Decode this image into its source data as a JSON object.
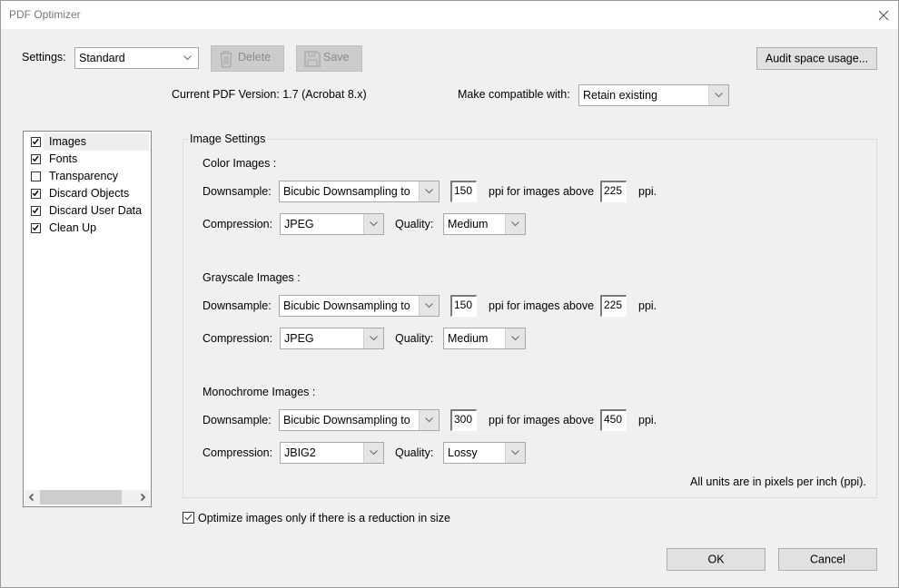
{
  "window": {
    "title": "PDF Optimizer",
    "close_icon": "close-icon"
  },
  "settings": {
    "label": "Settings:",
    "selected": "Standard",
    "delete_label": "Delete",
    "save_label": "Save",
    "audit_label": "Audit space usage..."
  },
  "version": {
    "current_text": "Current PDF Version: 1.7 (Acrobat 8.x)",
    "compat_label": "Make compatible with:",
    "compat_selected": "Retain existing"
  },
  "panels": [
    {
      "label": "Images",
      "checked": true,
      "selected": true
    },
    {
      "label": "Fonts",
      "checked": true,
      "selected": false
    },
    {
      "label": "Transparency",
      "checked": false,
      "selected": false
    },
    {
      "label": "Discard Objects",
      "checked": true,
      "selected": false
    },
    {
      "label": "Discard User Data",
      "checked": true,
      "selected": false
    },
    {
      "label": "Clean Up",
      "checked": true,
      "selected": false
    }
  ],
  "image_settings": {
    "title": "Image Settings",
    "downsample_label": "Downsample:",
    "compression_label": "Compression:",
    "quality_label": "Quality:",
    "ppi_above_label": "ppi for images above",
    "ppi_label": "ppi.",
    "color": {
      "heading": "Color Images :",
      "downsample": "Bicubic Downsampling to",
      "target_ppi": "150",
      "above_ppi": "225",
      "compression": "JPEG",
      "quality": "Medium"
    },
    "grayscale": {
      "heading": "Grayscale Images :",
      "downsample": "Bicubic Downsampling to",
      "target_ppi": "150",
      "above_ppi": "225",
      "compression": "JPEG",
      "quality": "Medium"
    },
    "monochrome": {
      "heading": "Monochrome Images :",
      "downsample": "Bicubic Downsampling to",
      "target_ppi": "300",
      "above_ppi": "450",
      "compression": "JBIG2",
      "quality": "Lossy"
    },
    "units_note": "All units are in pixels per inch (ppi)."
  },
  "optimize_only_if_smaller": {
    "label": "Optimize images only if there is a reduction in size",
    "checked": true
  },
  "footer": {
    "ok_label": "OK",
    "cancel_label": "Cancel"
  }
}
